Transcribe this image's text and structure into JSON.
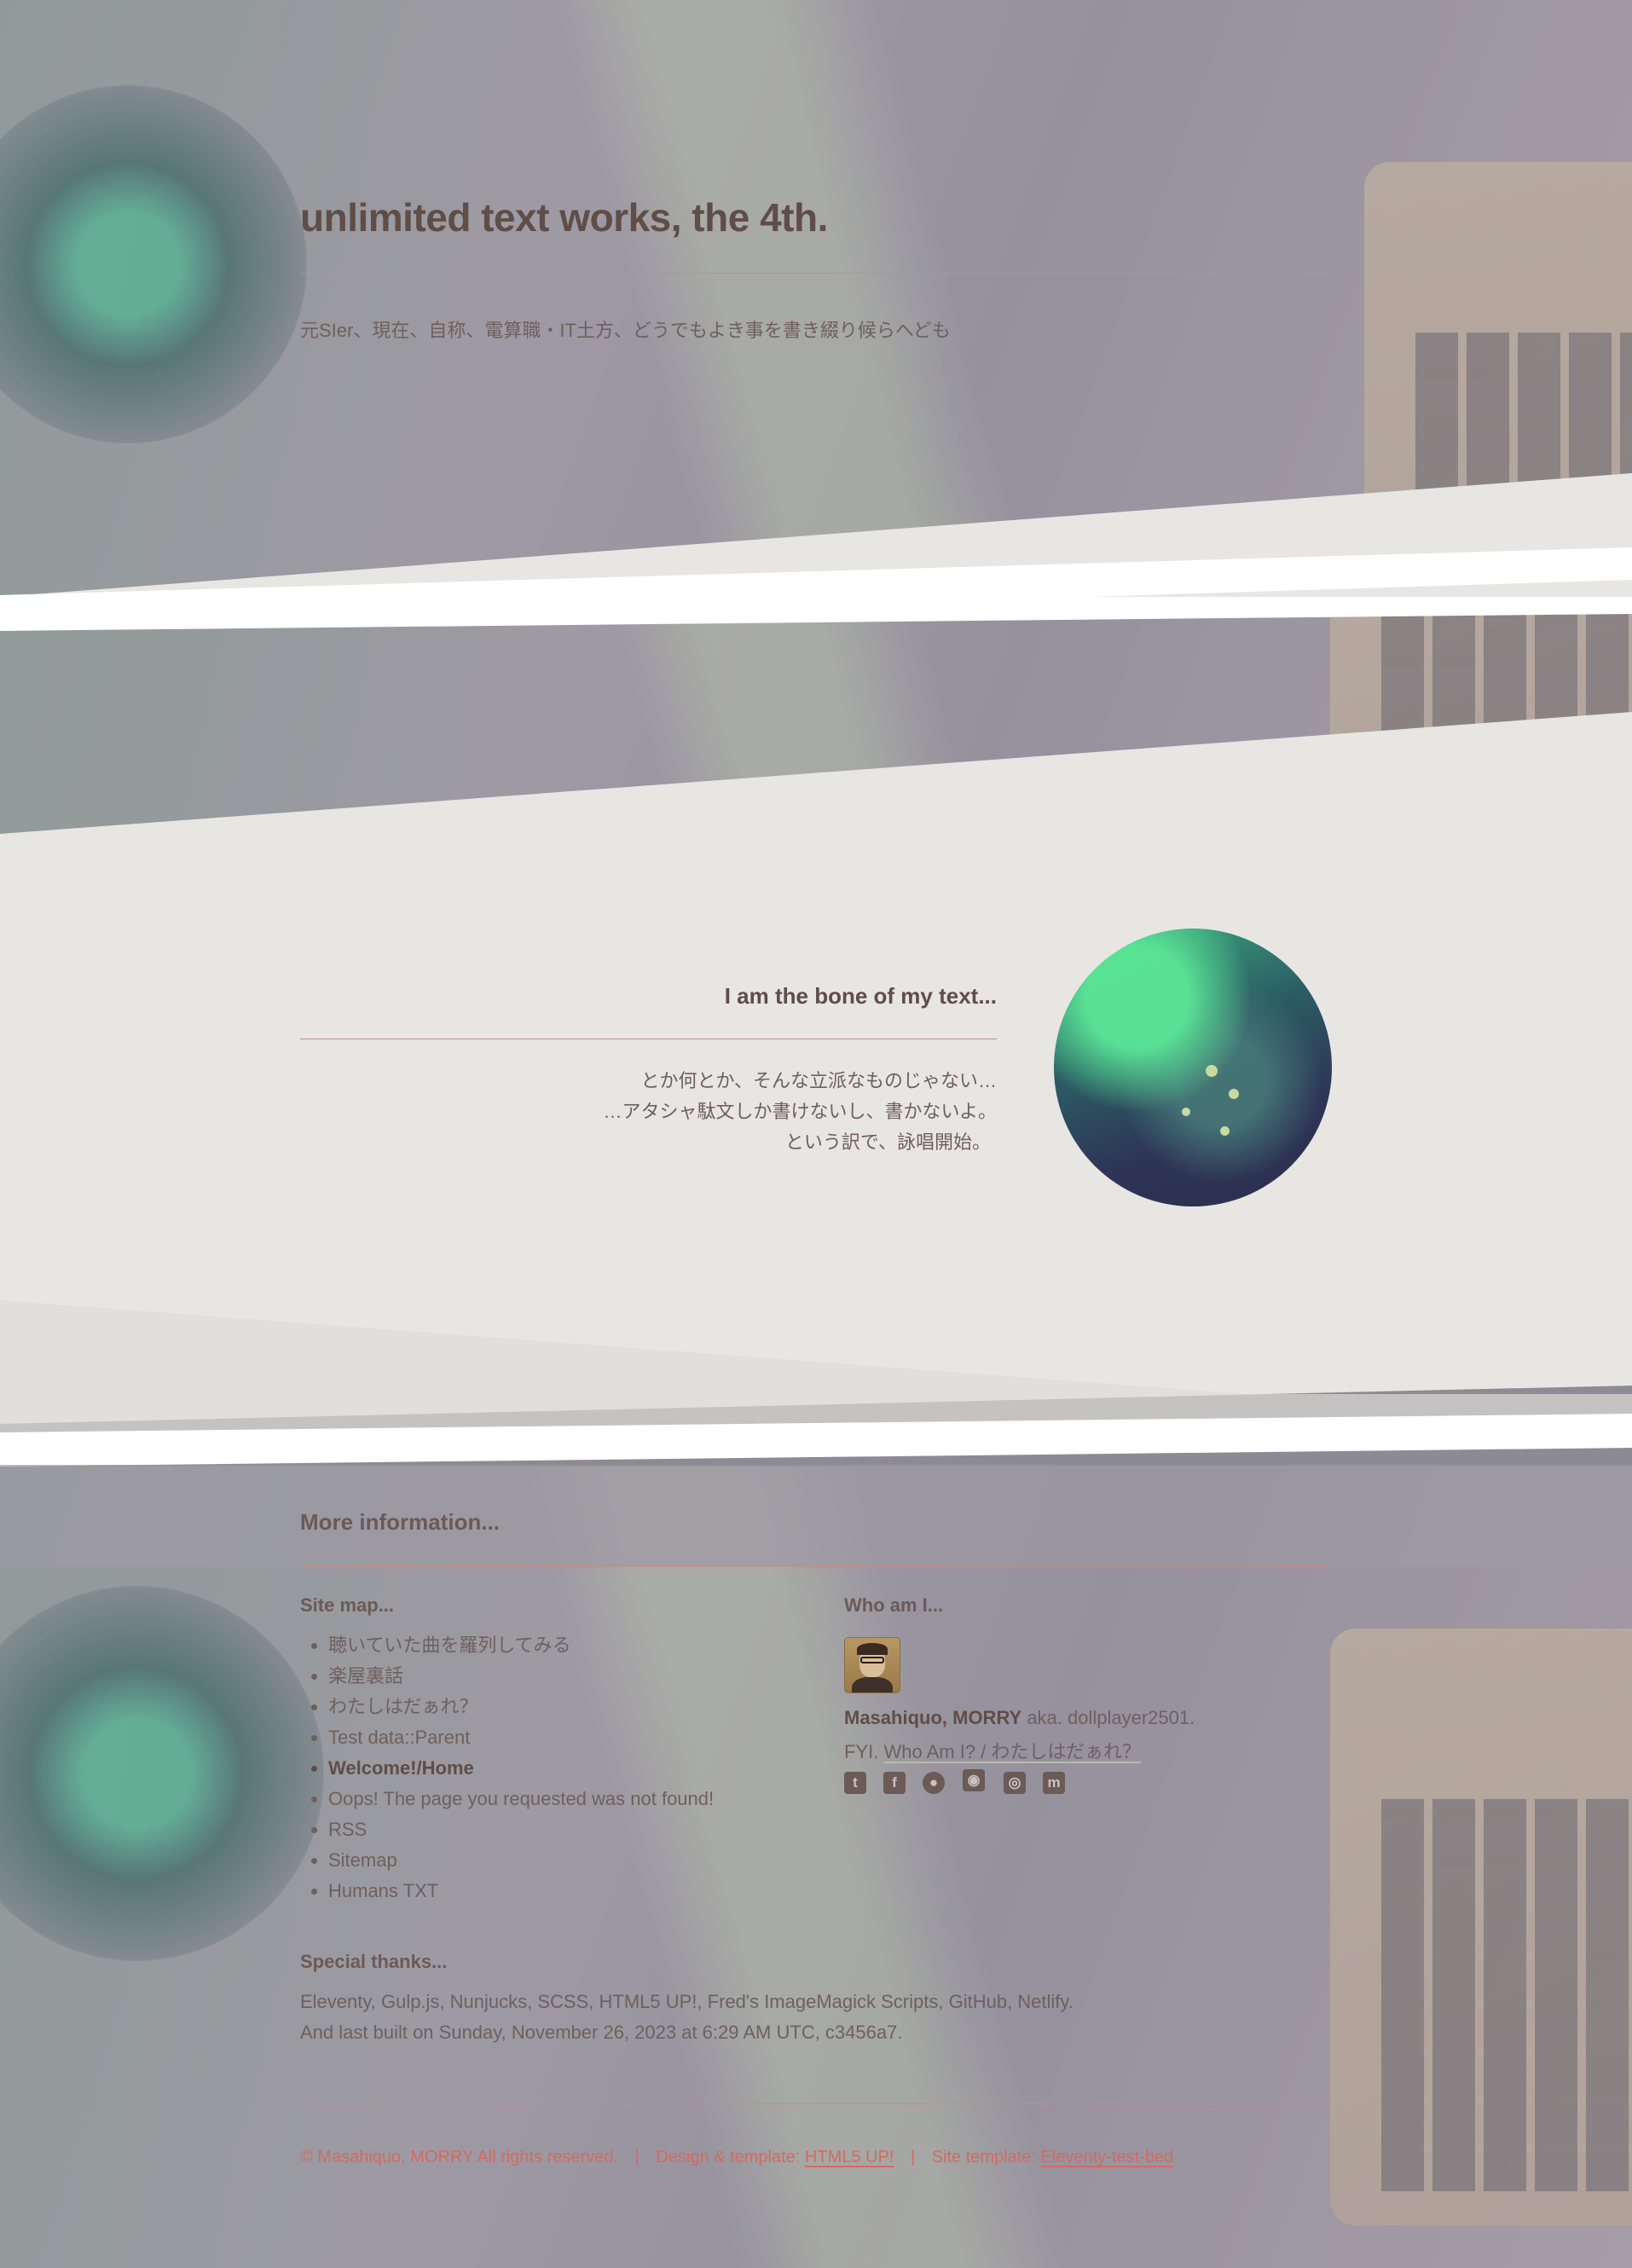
{
  "header": {
    "title": "unlimited text works, the 4th.",
    "description": "元SIer、現在、自称、電算職・IT土方、どうでもよき事を書き綴り候らへども"
  },
  "hero": {
    "title": "I am the bone of my text...",
    "lines": [
      "とか何とか、そんな立派なものじゃない…",
      "…アタシャ駄文しか書けないし、書かないよ。",
      "という訳で、詠唱開始。"
    ]
  },
  "footer": {
    "heading": "More information...",
    "sitemap": {
      "heading": "Site map...",
      "items": [
        "聴いていた曲を羅列してみる",
        "楽屋裏話",
        "わたしはだぁれ？",
        "Test data::Parent",
        "Welcome!/Home",
        "Oops! The page you requested was not found!",
        "RSS",
        "Sitemap",
        "Humans TXT"
      ]
    },
    "who": {
      "heading": "Who am I...",
      "name": "Masahiquo, MORRY",
      "aka": " aka. dollplayer2501.",
      "fyi_prefix": "FYI. ",
      "fyi_link": "Who Am I? / わたしはだぁれ？",
      "socials": [
        "twitter-icon",
        "facebook-icon",
        "github-icon",
        "discord-icon",
        "instagram-icon",
        "mastodon-icon"
      ]
    },
    "thanks": {
      "heading": "Special thanks...",
      "line1": "Eleventy, Gulp.js, Nunjucks, SCSS, HTML5 UP!, Fred's ImageMagick Scripts, GitHub, Netlify.",
      "line2": "And last built on Sunday, November 26, 2023 at 6:29 AM UTC, c3456a7."
    },
    "copyright": {
      "owner": "© Masahiquo, MORRY All rights reserved.",
      "sep": "|",
      "design_prefix": "Design & template: ",
      "design_link": "HTML5 UP!",
      "site_prefix": "Site template: ",
      "site_link": "Eleventy-test-bed"
    }
  },
  "colors": {
    "accent": "#d46a5f",
    "rule": "#c58c86",
    "panel": "#e8e6e3",
    "text": "#6b5a55"
  }
}
